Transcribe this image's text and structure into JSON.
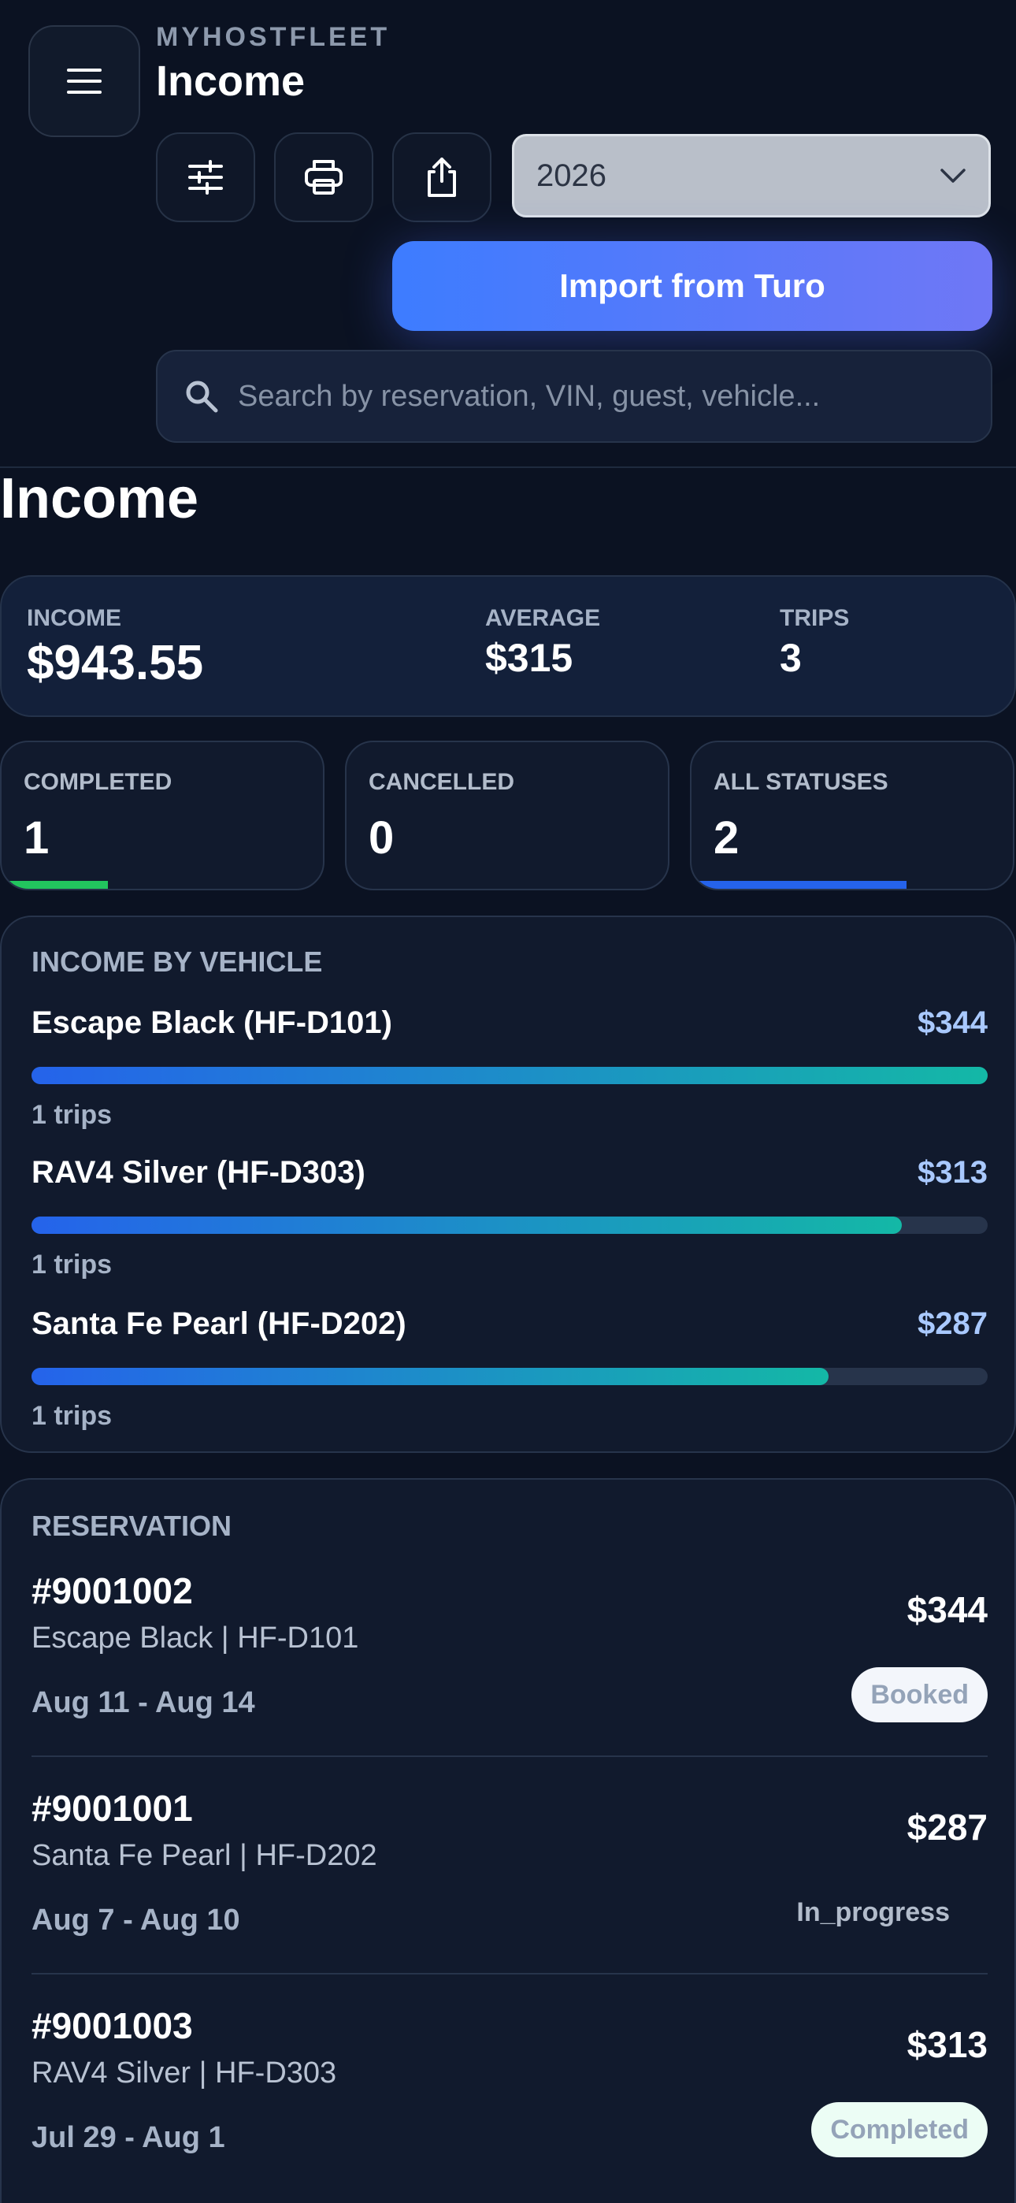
{
  "header": {
    "brand": "MYHOSTFLEET",
    "title": "Income",
    "year_select": "2026",
    "import_label": "Import from Turo",
    "search_placeholder": "Search by reservation, VIN, guest, vehicle..."
  },
  "section_title": "Income",
  "summary": {
    "income_label": "INCOME",
    "income_value": "$943.55",
    "average_label": "AVERAGE",
    "average_value": "$315",
    "trips_label": "TRIPS",
    "trips_value": "3"
  },
  "statuses": [
    {
      "label": "COMPLETED",
      "value": "1",
      "bar_fraction": 0.33,
      "bar_color": "#22c55e"
    },
    {
      "label": "CANCELLED",
      "value": "0",
      "bar_fraction": 0.0,
      "bar_color": "#ef4444"
    },
    {
      "label": "ALL STATUSES",
      "value": "2",
      "bar_fraction": 0.67,
      "bar_color": "#2563eb"
    }
  ],
  "vehicles": {
    "heading": "INCOME BY VEHICLE",
    "items": [
      {
        "name": "Escape Black (HF-D101)",
        "amount": "$344",
        "trips": "1 trips",
        "fraction": 1.0
      },
      {
        "name": "RAV4 Silver (HF-D303)",
        "amount": "$313",
        "trips": "1 trips",
        "fraction": 0.91
      },
      {
        "name": "Santa Fe Pearl (HF-D202)",
        "amount": "$287",
        "trips": "1 trips",
        "fraction": 0.834
      }
    ]
  },
  "reservations": {
    "heading": "RESERVATION",
    "items": [
      {
        "id": "#9001002",
        "vehicle": "Escape Black | HF-D101",
        "dates": "Aug 11 - Aug 14",
        "amount": "$344",
        "status": "Booked",
        "badge_bg": "#f3f6fb",
        "badge_fg": "#94a3b8"
      },
      {
        "id": "#9001001",
        "vehicle": "Santa Fe Pearl | HF-D202",
        "dates": "Aug 7 - Aug 10",
        "amount": "$287",
        "status": "In_progress",
        "badge_bg": "",
        "badge_fg": "#b2bccb"
      },
      {
        "id": "#9001003",
        "vehicle": "RAV4 Silver | HF-D303",
        "dates": "Jul 29 - Aug 1",
        "amount": "$313",
        "status": "Completed",
        "badge_bg": "#ecfdf5",
        "badge_fg": "#94a3b8"
      }
    ]
  }
}
